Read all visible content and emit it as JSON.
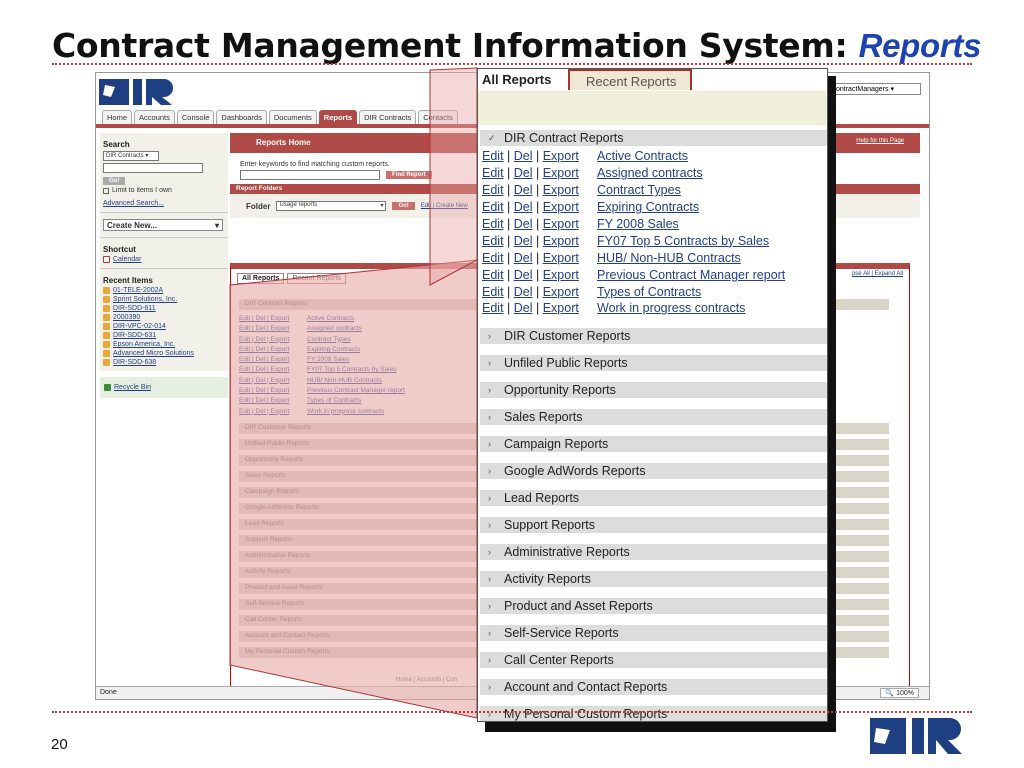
{
  "slide": {
    "title_main": "Contract Management Information System:",
    "title_emph": "Reports",
    "page_number": "20",
    "accent_color": "#cc3333"
  },
  "browser": {
    "logo": "DIR",
    "tabs": [
      "Home",
      "Accounts",
      "Console",
      "Dashboards",
      "Documents",
      "Reports",
      "DIR Contracts",
      "Contacts"
    ],
    "active_tab": "Reports",
    "top_select": "ontractManagers",
    "status": "Done",
    "zoom": "100%",
    "footer_links": "Home | Accounts | Con",
    "sidebar": {
      "search_heading": "Search",
      "search_scope": "DIR Contracts",
      "go_label": "Go!",
      "limit_label": "Limit to items I own",
      "advanced_search": "Advanced Search...",
      "create_new": "Create New...",
      "shortcut_heading": "Shortcut",
      "calendar": "Calendar",
      "recent_heading": "Recent Items",
      "recent_items": [
        "01-TELE-2002A",
        "Sprint Solutions, Inc.",
        "DIR-SDD-611",
        "2000390",
        "DIR-VPC-02-014",
        "DIR-SDD-631",
        "Epson America, Inc.",
        "Advanced Micro Solutions",
        "DIR-SDD-638"
      ],
      "recycle_bin": "Recycle Bin"
    },
    "main": {
      "reports_home": "Reports Home",
      "help_link": "Help for this Page",
      "find_hint": "Enter keywords to find matching custom reports.",
      "find_button": "Find Report",
      "report_folders": "Report Folders",
      "folder_label": "Folder",
      "folder_value": "Usage reports",
      "folder_go": "Go!",
      "folder_actions": "Edit | Create New",
      "expand_links": "pse All | Expand All",
      "small_tabs": [
        "All Reports",
        "Recent Reports"
      ]
    }
  },
  "zoom_panel": {
    "tabs": [
      "All Reports",
      "Recent Reports"
    ],
    "active_tab": "All Reports",
    "expanded_category": "DIR Contract Reports",
    "row_actions": [
      "Edit",
      "Del",
      "Export"
    ],
    "reports": [
      "Active Contracts",
      "Assigned contracts",
      "Contract Types",
      "Expiring Contracts",
      "FY 2008 Sales",
      "FY07 Top 5 Contracts by Sales",
      "HUB/ Non-HUB Contracts",
      "Previous Contract Manager report",
      "Types of Contracts",
      "Work in progress contracts"
    ],
    "categories": [
      "DIR Customer Reports",
      "Unfiled Public Reports",
      "Opportunity Reports",
      "Sales Reports",
      "Campaign Reports",
      "Google AdWords Reports",
      "Lead Reports",
      "Support Reports",
      "Administrative Reports",
      "Activity Reports",
      "Product and Asset Reports",
      "Self-Service Reports",
      "Call Center Reports",
      "Account and Contact Reports",
      "My Personal Custom Reports"
    ]
  },
  "mini_list": {
    "expanded_category": "DIR Contract Reports",
    "reports": [
      "Active Contracts",
      "Assigned contracts",
      "Contract Types",
      "Expiring Contracts",
      "FY 2008 Sales",
      "FY07 Top 5 Contracts by Sales",
      "HUB/ Non-HUB Contracts",
      "Previous Contract Manager report",
      "Types of Contracts",
      "Work in progress contracts"
    ],
    "categories": [
      "DIR Customer Reports",
      "Unfiled Public Reports",
      "Opportunity Reports",
      "Sales Reports",
      "Campaign Reports",
      "Google AdWords Reports",
      "Lead Reports",
      "Support Reports",
      "Administrative Reports",
      "Activity Reports",
      "Product and Asset Reports",
      "Self-Service Reports",
      "Call Center Reports",
      "Account and Contact Reports",
      "My Personal Custom Reports"
    ]
  }
}
